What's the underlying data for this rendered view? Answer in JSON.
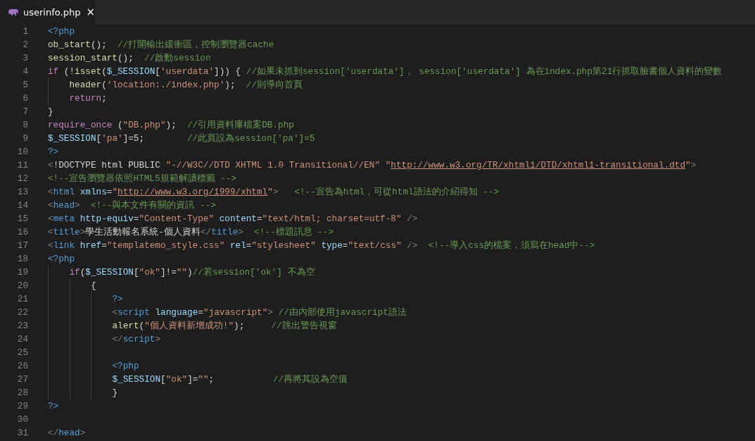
{
  "tabs": [
    {
      "label": "userinfo.php",
      "close": "×",
      "selected": true
    }
  ],
  "lines": [
    {
      "number": "1",
      "tokens": [
        {
          "kind": "phptag",
          "text": "<?php"
        }
      ]
    },
    {
      "number": "2",
      "tokens": [
        {
          "kind": "func",
          "text": "ob_start"
        },
        {
          "kind": "plain",
          "text": "();  "
        },
        {
          "kind": "comment",
          "text": "//打開輸出緩衝區，控制瀏覽器cache"
        }
      ]
    },
    {
      "number": "3",
      "tokens": [
        {
          "kind": "func",
          "text": "session_start"
        },
        {
          "kind": "plain",
          "text": "();  "
        },
        {
          "kind": "comment",
          "text": "//啟動session"
        }
      ]
    },
    {
      "number": "4",
      "tokens": [
        {
          "kind": "keyword",
          "text": "if"
        },
        {
          "kind": "plain",
          "text": " (!"
        },
        {
          "kind": "func",
          "text": "isset"
        },
        {
          "kind": "plain",
          "text": "("
        },
        {
          "kind": "var",
          "text": "$_SESSION"
        },
        {
          "kind": "plain",
          "text": "["
        },
        {
          "kind": "string",
          "text": "'userdata'"
        },
        {
          "kind": "plain",
          "text": "])) { "
        },
        {
          "kind": "comment",
          "text": "//如果未抓到session['userdata']， session['userdata'] 為在index.php第21行抓取臉書個人資料的變數"
        }
      ],
      "children": [
        {
          "number": "5",
          "tokens": [
            {
              "kind": "func",
              "text": "header"
            },
            {
              "kind": "plain",
              "text": "("
            },
            {
              "kind": "string",
              "text": "'location:./index.php'"
            },
            {
              "kind": "plain",
              "text": ");  "
            },
            {
              "kind": "comment",
              "text": "//則導向首頁"
            }
          ]
        },
        {
          "number": "6",
          "tokens": [
            {
              "kind": "keyword",
              "text": "return"
            },
            {
              "kind": "plain",
              "text": ";"
            }
          ]
        }
      ]
    },
    {
      "number": "7",
      "tokens": [
        {
          "kind": "plain",
          "text": "}"
        }
      ]
    },
    {
      "number": "8",
      "tokens": [
        {
          "kind": "keyword",
          "text": "require_once"
        },
        {
          "kind": "plain",
          "text": " ("
        },
        {
          "kind": "string",
          "text": "\"DB.php\""
        },
        {
          "kind": "plain",
          "text": ");  "
        },
        {
          "kind": "comment",
          "text": "//引用資料庫檔案DB.php"
        }
      ]
    },
    {
      "number": "9",
      "tokens": [
        {
          "kind": "var",
          "text": "$_SESSION"
        },
        {
          "kind": "plain",
          "text": "["
        },
        {
          "kind": "string",
          "text": "'pa'"
        },
        {
          "kind": "plain",
          "text": "]=5;        "
        },
        {
          "kind": "comment",
          "text": "//此頁設為session['pa']=5"
        }
      ]
    },
    {
      "number": "10",
      "tokens": [
        {
          "kind": "phptag",
          "text": "?>"
        }
      ]
    },
    {
      "number": "11",
      "tokens": [
        {
          "kind": "punct",
          "text": "<"
        },
        {
          "kind": "plain",
          "text": "!DOCTYPE html PUBLIC "
        },
        {
          "kind": "string",
          "text": "\"-//W3C//DTD XHTML 1.0 Transitional//EN\" \""
        },
        {
          "kind": "link",
          "text": "http://www.w3.org/TR/xhtml1/DTD/xhtml1-transitional.dtd"
        },
        {
          "kind": "string",
          "text": "\""
        },
        {
          "kind": "punct",
          "text": ">"
        }
      ]
    },
    {
      "number": "12",
      "tokens": [
        {
          "kind": "comment",
          "text": "<!--宣告瀏覽器依照HTML5規範解讀標籤 -->"
        }
      ]
    },
    {
      "number": "13",
      "tokens": [
        {
          "kind": "punct",
          "text": "<"
        },
        {
          "kind": "tag",
          "text": "html "
        },
        {
          "kind": "attr",
          "text": "xmlns"
        },
        {
          "kind": "plain",
          "text": "="
        },
        {
          "kind": "string",
          "text": "\""
        },
        {
          "kind": "link",
          "text": "http://www.w3.org/1999/xhtml"
        },
        {
          "kind": "string",
          "text": "\""
        },
        {
          "kind": "punct",
          "text": ">   "
        },
        {
          "kind": "comment",
          "text": "<!--宣告為html，可從html語法的介紹得知 -->"
        }
      ]
    },
    {
      "number": "14",
      "tokens": [
        {
          "kind": "punct",
          "text": "<"
        },
        {
          "kind": "tag",
          "text": "head"
        },
        {
          "kind": "punct",
          "text": ">  "
        },
        {
          "kind": "comment",
          "text": "<!--與本文件有關的資訊 -->"
        }
      ]
    },
    {
      "number": "15",
      "tokens": [
        {
          "kind": "punct",
          "text": "<"
        },
        {
          "kind": "tag",
          "text": "meta "
        },
        {
          "kind": "attr",
          "text": "http-equiv"
        },
        {
          "kind": "plain",
          "text": "="
        },
        {
          "kind": "string",
          "text": "\"Content-Type\" "
        },
        {
          "kind": "attr",
          "text": "content"
        },
        {
          "kind": "plain",
          "text": "="
        },
        {
          "kind": "string",
          "text": "\"text/html; charset=utf-8\" "
        },
        {
          "kind": "punct",
          "text": "/>"
        }
      ]
    },
    {
      "number": "16",
      "tokens": [
        {
          "kind": "punct",
          "text": "<"
        },
        {
          "kind": "tag",
          "text": "title"
        },
        {
          "kind": "punct",
          "text": ">"
        },
        {
          "kind": "plain",
          "text": "學生活動報名系統-個人資料"
        },
        {
          "kind": "punct",
          "text": "</"
        },
        {
          "kind": "tag",
          "text": "title"
        },
        {
          "kind": "punct",
          "text": ">  "
        },
        {
          "kind": "comment",
          "text": "<!--標題訊息 -->"
        }
      ]
    },
    {
      "number": "17",
      "tokens": [
        {
          "kind": "punct",
          "text": "<"
        },
        {
          "kind": "tag",
          "text": "link "
        },
        {
          "kind": "attr",
          "text": "href"
        },
        {
          "kind": "plain",
          "text": "="
        },
        {
          "kind": "string",
          "text": "\"templatemo_style.css\" "
        },
        {
          "kind": "attr",
          "text": "rel"
        },
        {
          "kind": "plain",
          "text": "="
        },
        {
          "kind": "string",
          "text": "\"stylesheet\" "
        },
        {
          "kind": "attr",
          "text": "type"
        },
        {
          "kind": "plain",
          "text": "="
        },
        {
          "kind": "string",
          "text": "\"text/css\" "
        },
        {
          "kind": "punct",
          "text": "/>  "
        },
        {
          "kind": "comment",
          "text": "<!--導入css的檔案，須寫在head中-->"
        }
      ]
    },
    {
      "number": "18",
      "tokens": [
        {
          "kind": "phptag",
          "text": "<?php"
        }
      ],
      "children": [
        {
          "number": "19",
          "tokens": [
            {
              "kind": "keyword",
              "text": "if"
            },
            {
              "kind": "plain",
              "text": "("
            },
            {
              "kind": "var",
              "text": "$_SESSION"
            },
            {
              "kind": "plain",
              "text": "["
            },
            {
              "kind": "string",
              "text": "\"ok\""
            },
            {
              "kind": "plain",
              "text": "]!="
            },
            {
              "kind": "string",
              "text": "\"\""
            },
            {
              "kind": "plain",
              "text": ")"
            },
            {
              "kind": "comment",
              "text": "//若session['ok'] 不為空"
            }
          ],
          "children": [
            {
              "number": "20",
              "tokens": [
                {
                  "kind": "plain",
                  "text": "{"
                }
              ],
              "children": [
                {
                  "number": "21",
                  "tokens": [
                    {
                      "kind": "phptag",
                      "text": "?>"
                    }
                  ]
                },
                {
                  "number": "22",
                  "tokens": [
                    {
                      "kind": "punct",
                      "text": "<"
                    },
                    {
                      "kind": "tag",
                      "text": "script "
                    },
                    {
                      "kind": "attr",
                      "text": "language"
                    },
                    {
                      "kind": "plain",
                      "text": "="
                    },
                    {
                      "kind": "string",
                      "text": "\"javascript\""
                    },
                    {
                      "kind": "punct",
                      "text": "> "
                    },
                    {
                      "kind": "comment",
                      "text": "//由內部使用javascript語法"
                    }
                  ]
                },
                {
                  "number": "23",
                  "tokens": [
                    {
                      "kind": "func",
                      "text": "alert"
                    },
                    {
                      "kind": "plain",
                      "text": "("
                    },
                    {
                      "kind": "string",
                      "text": "\"個人資料新增成功!\""
                    },
                    {
                      "kind": "plain",
                      "text": ");     "
                    },
                    {
                      "kind": "comment",
                      "text": "//跳出警告視窗"
                    }
                  ]
                },
                {
                  "number": "24",
                  "tokens": [
                    {
                      "kind": "punct",
                      "text": "</"
                    },
                    {
                      "kind": "tag",
                      "text": "script"
                    },
                    {
                      "kind": "punct",
                      "text": ">"
                    }
                  ]
                },
                {
                  "number": "25"
                },
                {
                  "number": "26",
                  "tokens": [
                    {
                      "kind": "phptag",
                      "text": "<?php"
                    }
                  ]
                },
                {
                  "number": "27",
                  "tokens": [
                    {
                      "kind": "var",
                      "text": "$_SESSION"
                    },
                    {
                      "kind": "plain",
                      "text": "["
                    },
                    {
                      "kind": "string",
                      "text": "\"ok\""
                    },
                    {
                      "kind": "plain",
                      "text": "]="
                    },
                    {
                      "kind": "string",
                      "text": "\"\""
                    },
                    {
                      "kind": "plain",
                      "text": ";           "
                    },
                    {
                      "kind": "comment",
                      "text": "//再將其設為空值"
                    }
                  ]
                },
                {
                  "number": "28",
                  "tokens": [
                    {
                      "kind": "plain",
                      "text": "}"
                    }
                  ]
                }
              ]
            }
          ]
        }
      ]
    },
    {
      "number": "29",
      "tokens": [
        {
          "kind": "phptag",
          "text": "?>"
        }
      ]
    },
    {
      "number": "30"
    },
    {
      "number": "31",
      "tokens": [
        {
          "kind": "punct",
          "text": "</"
        },
        {
          "kind": "tag",
          "text": "head"
        },
        {
          "kind": "punct",
          "text": ">"
        }
      ]
    }
  ]
}
